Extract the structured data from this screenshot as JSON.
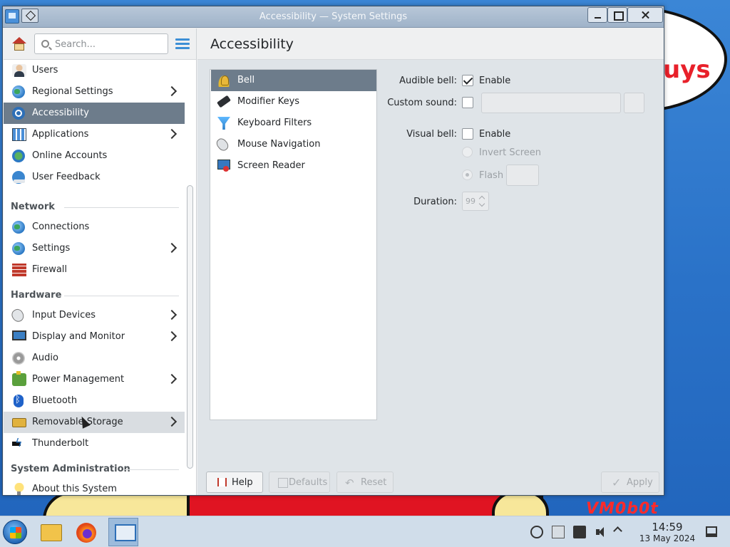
{
  "window": {
    "title": "Accessibility — System Settings"
  },
  "search": {
    "placeholder": "Search..."
  },
  "sidebar": {
    "items_top": [
      {
        "label": "Users",
        "icon": "users-icon"
      },
      {
        "label": "Regional Settings",
        "icon": "globe-icon",
        "has_submenu": true
      },
      {
        "label": "Accessibility",
        "icon": "accessibility-icon",
        "selected": true
      },
      {
        "label": "Applications",
        "icon": "applications-icon",
        "has_submenu": true
      },
      {
        "label": "Online Accounts",
        "icon": "online-accounts-icon"
      },
      {
        "label": "User Feedback",
        "icon": "user-feedback-icon"
      }
    ],
    "sections": {
      "network": "Network",
      "hardware": "Hardware",
      "sysadmin": "System Administration"
    },
    "network_items": [
      {
        "label": "Connections",
        "icon": "connections-icon"
      },
      {
        "label": "Settings",
        "icon": "network-settings-icon",
        "has_submenu": true
      },
      {
        "label": "Firewall",
        "icon": "firewall-icon"
      }
    ],
    "hardware_items": [
      {
        "label": "Input Devices",
        "icon": "mouse-icon",
        "has_submenu": true
      },
      {
        "label": "Display and Monitor",
        "icon": "display-icon",
        "has_submenu": true
      },
      {
        "label": "Audio",
        "icon": "audio-icon"
      },
      {
        "label": "Power Management",
        "icon": "power-icon",
        "has_submenu": true
      },
      {
        "label": "Bluetooth",
        "icon": "bluetooth-icon"
      },
      {
        "label": "Removable Storage",
        "icon": "storage-icon",
        "has_submenu": true,
        "hovered": true
      },
      {
        "label": "Thunderbolt",
        "icon": "thunderbolt-icon"
      }
    ],
    "sysadmin_items": [
      {
        "label": "About this System",
        "icon": "info-icon"
      }
    ]
  },
  "main": {
    "title": "Accessibility",
    "categories": [
      {
        "label": "Bell",
        "icon": "bell-icon",
        "selected": true
      },
      {
        "label": "Modifier Keys",
        "icon": "keyboard-icon"
      },
      {
        "label": "Keyboard Filters",
        "icon": "filter-icon"
      },
      {
        "label": "Mouse Navigation",
        "icon": "mouse-icon"
      },
      {
        "label": "Screen Reader",
        "icon": "screen-reader-icon"
      }
    ],
    "bell": {
      "audible_label": "Audible bell:",
      "audible_enable": "Enable",
      "audible_checked": true,
      "custom_sound_label": "Custom sound:",
      "custom_sound_checked": false,
      "visual_label": "Visual bell:",
      "visual_enable": "Enable",
      "visual_checked": false,
      "invert_screen": "Invert Screen",
      "flash": "Flash",
      "duration_label": "Duration:",
      "duration_value": "99"
    },
    "buttons": {
      "help": "Help",
      "defaults": "Defaults",
      "reset": "Reset",
      "apply": "Apply"
    }
  },
  "wallpaper": {
    "text_right": "uys",
    "watermark": "VM0b0t"
  },
  "taskbar": {
    "time": "14:59",
    "date": "13 May 2024"
  },
  "colors": {
    "selection": "#6d7c8b",
    "accent": "#3d8fd6",
    "desktop": "#2a72c8"
  }
}
